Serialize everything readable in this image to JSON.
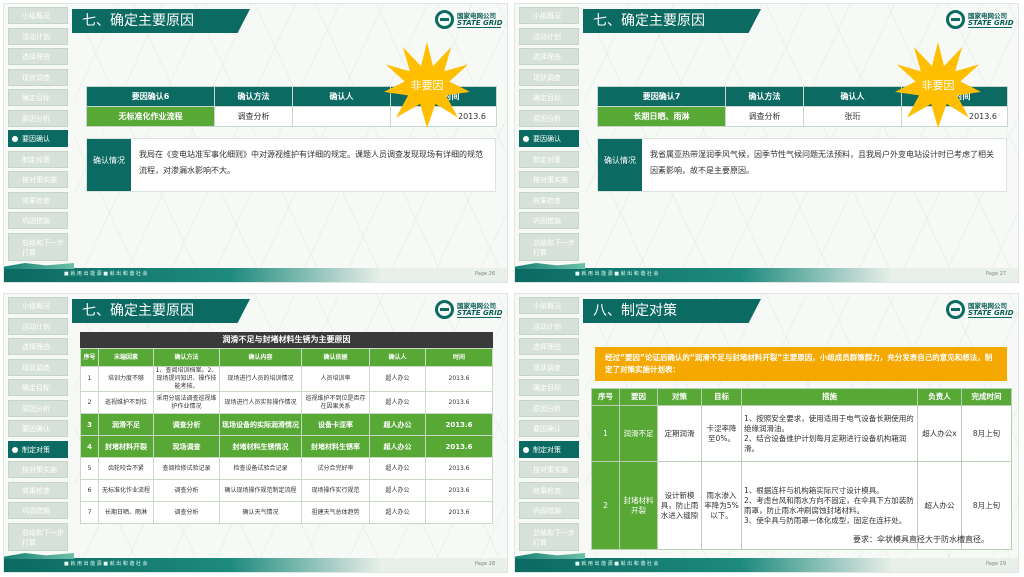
{
  "nav": [
    "小组概况",
    "活动计划",
    "选择理由",
    "现状调查",
    "确定目标",
    "原因分析",
    "要因确认",
    "制定对策",
    "按对策实施",
    "效果检查",
    "巩固措施",
    "总结和下一步打算"
  ],
  "footer_slogan": "■ 就 用 出 能 源   ■ 就 出 和 谐 社 会",
  "slide1": {
    "title": "七、确定主要原因",
    "burst": "非要因",
    "headers": [
      "要因确认6",
      "确认方法",
      "确认人",
      "确认时间"
    ],
    "row": [
      "无标准化作业流程",
      "调查分析",
      "",
      "2013.6"
    ],
    "desc_label": "确认情况",
    "desc": "我局在《变电站准军事化细则》中对源视维护有详细的规定。课题人员调查发现现场有详细的规范流程，对渗漏水影响不大。",
    "page": "Page 26"
  },
  "slide2": {
    "title": "七、确定主要原因",
    "burst": "非要因",
    "headers": [
      "要因确认7",
      "确认方法",
      "确认人",
      "确认时间"
    ],
    "row": [
      "长期日晒、雨淋",
      "调查分析",
      "张珩",
      "2013.6"
    ],
    "desc_label": "确认情况",
    "desc": "我省属亚热带湿润季风气候，因季节性气候问题无法预料，且我局户外变电站设计时已考虑了相关因素影响，故不是主要原因。",
    "page": "Page 27",
    "pnum": "27"
  },
  "slide3": {
    "title": "七、确定主要原因",
    "caption": "润滑不足与封堵材料生锈为主要原因",
    "headers": [
      "序号",
      "末端因素",
      "确认方法",
      "确认内容",
      "确认依据",
      "确认人",
      "时间"
    ],
    "rows": [
      {
        "hl": false,
        "cells": [
          "1",
          "培训力度不够",
          "1、查阅培训档案。2、现场提问知识、操作技能考核。",
          "现场进行人员的培训情况",
          "人员培训率",
          "超人办公",
          "2013.6"
        ]
      },
      {
        "hl": false,
        "cells": [
          "2",
          "巡视维护不到位",
          "采用分层法调查巡视维护作业情况",
          "现场进行人员实际操作情况",
          "巡视维护不到位是否存在因果关系",
          "超人办公",
          "2013.6"
        ]
      },
      {
        "hl": true,
        "cells": [
          "3",
          "润滑不足",
          "调查分析",
          "现场设备的实际润滑情况",
          "设备卡涩率",
          "超人办公",
          "2013.6"
        ]
      },
      {
        "hl": true,
        "cells": [
          "4",
          "封堵材料开裂",
          "现场调查",
          "封堵材料生锈情况",
          "封堵材料生锈率",
          "超人办公",
          "2013.6"
        ]
      },
      {
        "hl": false,
        "cells": [
          "5",
          "齿轮咬合不紧",
          "查阅检修试验记录",
          "检查设备试验合记录",
          "试分合完好率",
          "超人办公",
          "2013.6"
        ]
      },
      {
        "hl": false,
        "cells": [
          "6",
          "无标准化作业流程",
          "调查分析",
          "确认现场操作规范制定流程",
          "现场操作实行规范",
          "超人办公",
          "2013.6"
        ]
      },
      {
        "hl": false,
        "cells": [
          "7",
          "长期日晒、雨淋",
          "调查分析",
          "确认天气情况",
          "祖建天气总体趋势",
          "超人办公",
          "2013.6"
        ]
      }
    ],
    "page": "Page 28"
  },
  "slide4": {
    "title": "八、制定对策",
    "intro": "经过“要因”论证后确认的“润滑不足与封堵材料开裂”主要原因，小组成员群策群力，充分发表自己的意见和想法，制定了对策实施计划表：",
    "headers": [
      "序号",
      "要因",
      "对策",
      "目标",
      "措施",
      "负责人",
      "完成时间"
    ],
    "rows": [
      {
        "cells": [
          "1",
          "润滑不足",
          "定期润滑",
          "卡涩率降至0%。",
          "1、按照安全要求，使用适用于电气设备长期使用的绝缘润滑油。\n2、结合设备维护计划每月定期进行设备机构箱润滑。",
          "超人办公x",
          "8月上旬"
        ]
      },
      {
        "cells": [
          "2",
          "封堵材料开裂",
          "设计新模具，防止雨水进入缝隙",
          "雨水渗入率降为5%以下。",
          "1、根据连杆与机构箱实际尺寸设计模具。\n2、考虑台风和雨水方向不固定，在伞具下方加装防雨罩，防止雨水冲刷腐蚀封堵材料。\n3、使伞具与防雨罩一体化成型，固定在连杆处。",
          "超人办公",
          "8月上旬"
        ]
      }
    ],
    "req": "要求：伞状模具直径大于防水槽直径。",
    "page": "Page 29"
  },
  "logo": {
    "cn": "国家电网公司",
    "en": "STATE GRID"
  }
}
